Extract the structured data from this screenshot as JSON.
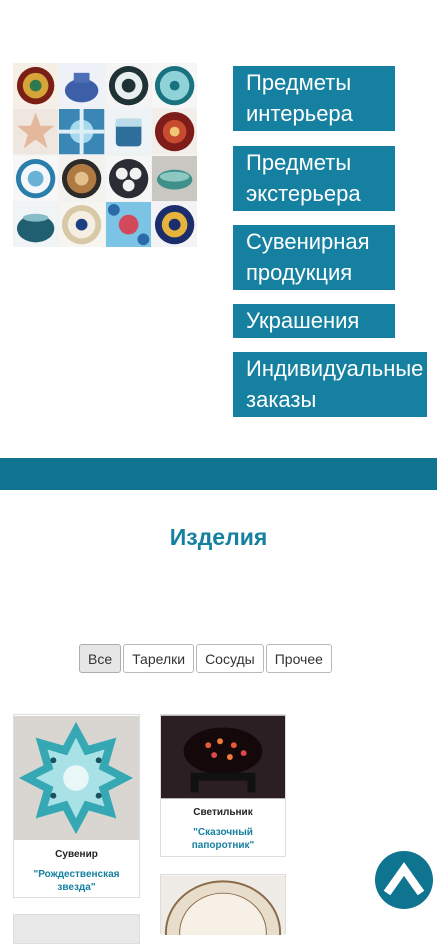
{
  "categories": [
    "Предметы\nинтерьера",
    "Предметы\nэкстерьера",
    "Сувенирная\nпродукция",
    "Украшения",
    "Индивидуальные\nзаказы"
  ],
  "products_section": {
    "title": "Изделия",
    "filters": [
      "Все",
      "Тарелки",
      "Сосуды",
      "Прочее"
    ],
    "active_filter": "Все"
  },
  "products": [
    {
      "category": "Сувенир",
      "name": "\"Рождественская звезда\""
    },
    {
      "category": "Светильник",
      "name": "\"Сказочный папоротник\""
    }
  ],
  "colors": {
    "accent": "#1580a0",
    "band": "#0f7490"
  },
  "icons": {
    "scroll_top": "chevron-up-icon"
  }
}
